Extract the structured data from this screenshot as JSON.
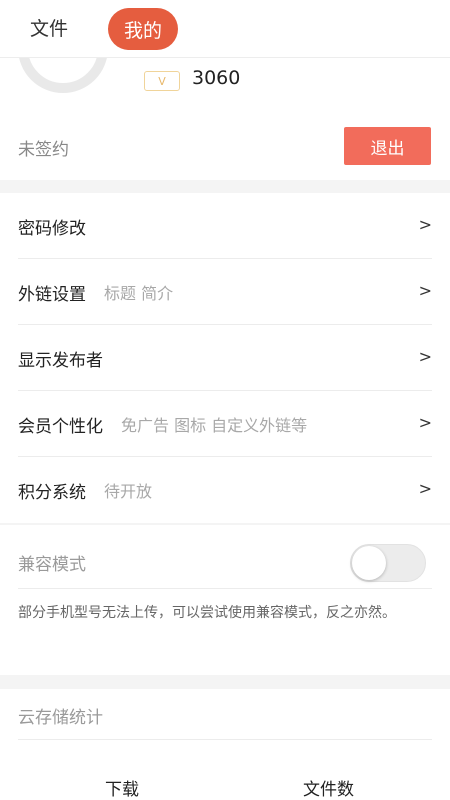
{
  "tabs": {
    "file": "文件",
    "mine": "我的"
  },
  "profile": {
    "vip_label": "V",
    "score": "3060"
  },
  "account": {
    "sign_status": "未签约",
    "logout_label": "退出"
  },
  "menu": {
    "items": [
      {
        "title": "密码修改",
        "subtitle": "",
        "arrow": ">"
      },
      {
        "title": "外链设置",
        "subtitle": "标题 简介",
        "arrow": ">"
      },
      {
        "title": "显示发布者",
        "subtitle": "",
        "arrow": ">"
      },
      {
        "title": "会员个性化",
        "subtitle": "免广告 图标 自定义外链等",
        "arrow": ">"
      },
      {
        "title": "积分系统",
        "subtitle": "待开放",
        "arrow": ">"
      }
    ]
  },
  "compat": {
    "label": "兼容模式",
    "enabled": false,
    "description": "部分手机型号无法上传，可以尝试使用兼容模式，反之亦然。"
  },
  "cloud": {
    "title": "云存储统计",
    "download_label": "下载",
    "files_label": "文件数"
  },
  "colors": {
    "accent": "#e55d3f",
    "logout": "#f26c5b",
    "vip": "#e8b86b"
  }
}
